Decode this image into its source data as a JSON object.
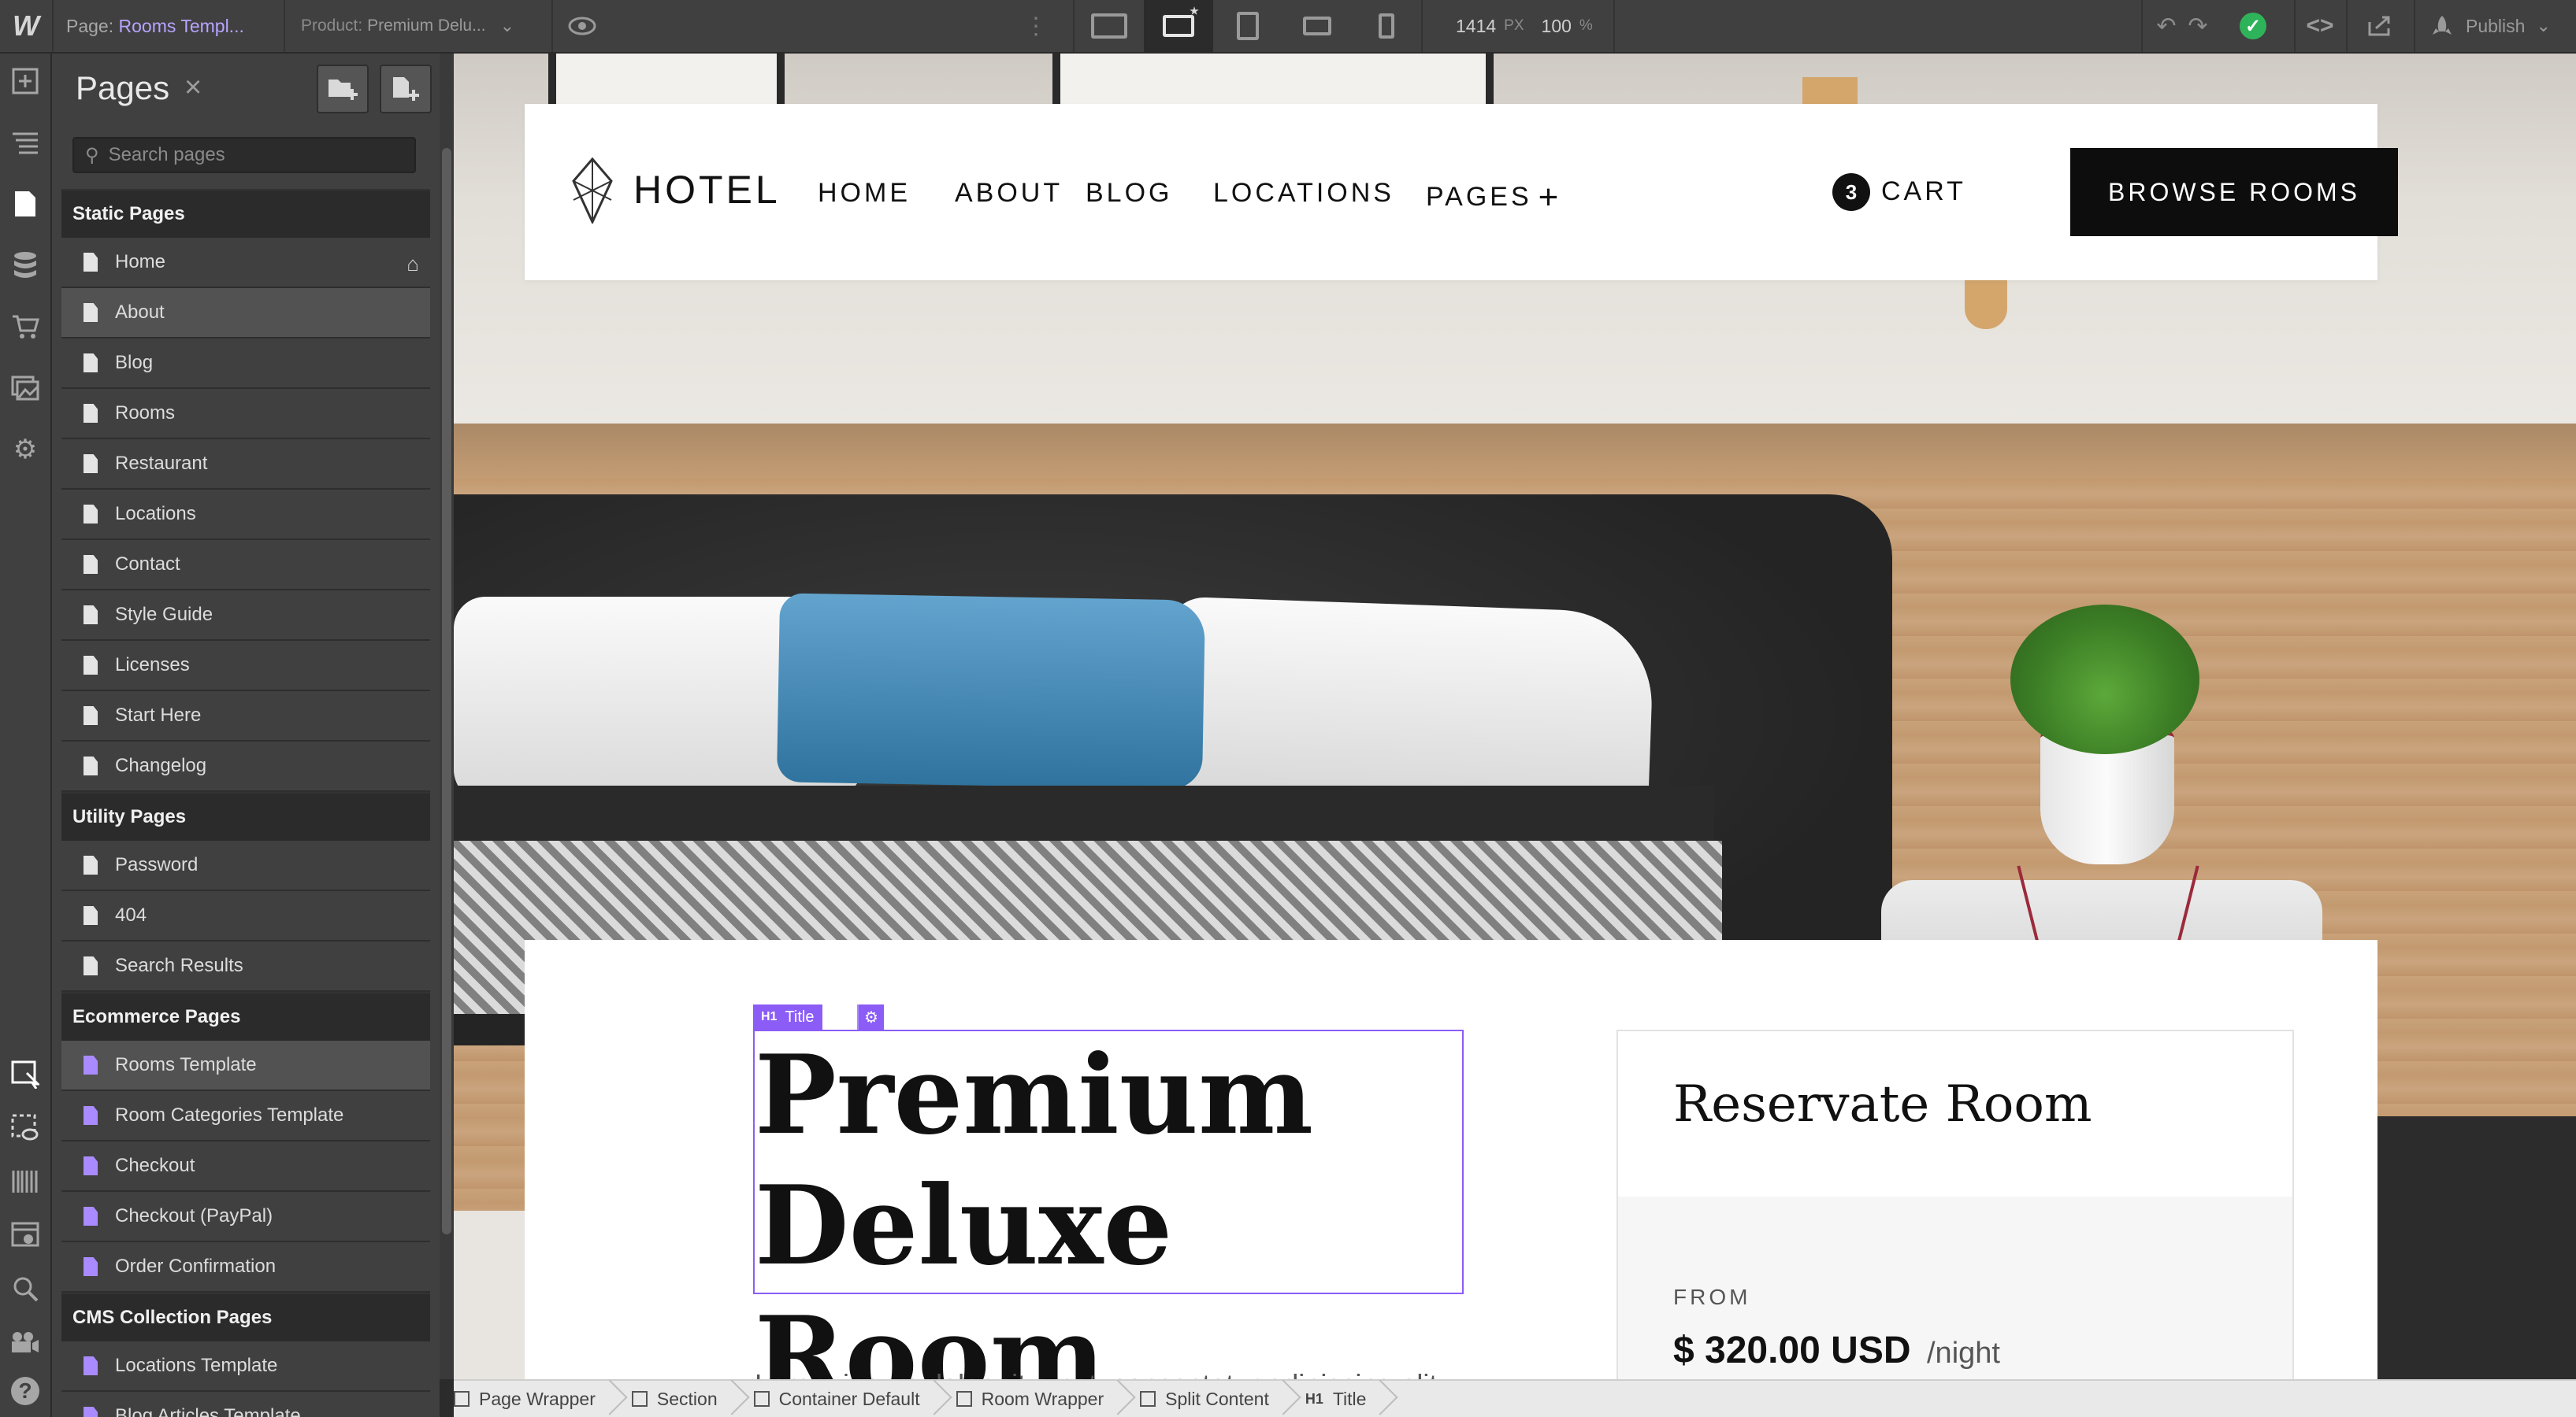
{
  "topbar": {
    "logo": "W",
    "page_label": "Page:",
    "page_name": "Rooms Templ...",
    "product_label": "Product:",
    "product_name": "Premium Delu...",
    "width_value": "1414",
    "width_unit": "PX",
    "zoom_value": "100",
    "zoom_unit": "%",
    "publish_label": "Publish"
  },
  "pages_panel": {
    "title": "Pages",
    "search_placeholder": "Search pages",
    "sections": [
      {
        "title": "Static Pages",
        "items": [
          "Home",
          "About",
          "Blog",
          "Rooms",
          "Restaurant",
          "Locations",
          "Contact",
          "Style Guide",
          "Licenses",
          "Start Here",
          "Changelog"
        ]
      },
      {
        "title": "Utility Pages",
        "items": [
          "Password",
          "404",
          "Search Results"
        ]
      },
      {
        "title": "Ecommerce Pages",
        "items": [
          "Rooms Template",
          "Room Categories Template",
          "Checkout",
          "Checkout (PayPal)",
          "Order Confirmation"
        ]
      },
      {
        "title": "CMS Collection Pages",
        "items": [
          "Locations Template",
          "Blog Articles Template"
        ]
      }
    ]
  },
  "site": {
    "brand": "HOTEL",
    "nav": [
      "HOME",
      "ABOUT",
      "BLOG",
      "LOCATIONS",
      "PAGES"
    ],
    "nav_plus": "+",
    "cart_count": "3",
    "cart_label": "CART",
    "browse_button": "BROWSE ROOMS",
    "selection_tag": "Title",
    "selection_tag_prefix": "H1",
    "title_line1": "Premium",
    "title_line2": "Deluxe Room",
    "lead": "Lorem ipsum dolor sit amet, consectetur adipiscing elit.",
    "reserve_title": "Reservate Room",
    "from_label": "FROM",
    "price": "$ 320.00 USD",
    "per_label": "/night"
  },
  "breadcrumbs": [
    "Page Wrapper",
    "Section",
    "Container Default",
    "Room Wrapper",
    "Split Content",
    "Title"
  ],
  "breadcrumb_h1_prefix": "H1",
  "colors": {
    "accent_purple": "#8b5cf6",
    "status_green": "#2fb35a",
    "ui_dark": "#404040"
  }
}
